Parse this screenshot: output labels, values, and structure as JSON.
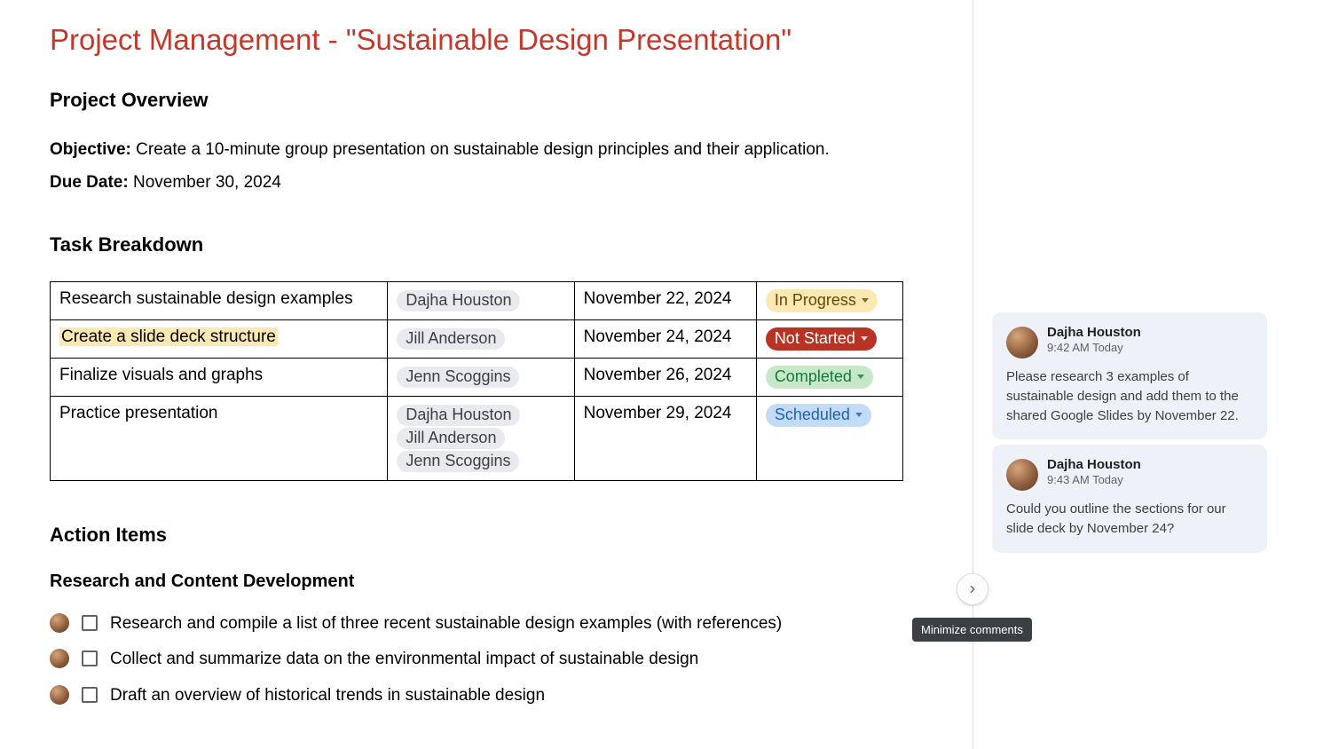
{
  "title": "Project Management - \"Sustainable Design Presentation\"",
  "overview": {
    "heading": "Project Overview",
    "objective_label": "Objective: ",
    "objective_text": "Create a 10-minute group presentation on sustainable design principles and their application.",
    "due_label": "Due Date: ",
    "due_text": "November 30, 2024"
  },
  "tasks": {
    "heading": "Task Breakdown",
    "rows": [
      {
        "task": "Research sustainable design examples",
        "highlight": false,
        "people": [
          "Dajha Houston"
        ],
        "date": "November 22, 2024",
        "status": "In Progress",
        "status_class": "st-progress"
      },
      {
        "task": "Create a slide deck structure",
        "highlight": true,
        "people": [
          "Jill Anderson"
        ],
        "date": "November 24, 2024",
        "status": "Not Started",
        "status_class": "st-notstart"
      },
      {
        "task": "Finalize visuals and graphs",
        "highlight": false,
        "people": [
          "Jenn Scoggins"
        ],
        "date": "November 26, 2024",
        "status": "Completed",
        "status_class": "st-completed"
      },
      {
        "task": "Practice presentation",
        "highlight": false,
        "people": [
          "Dajha Houston",
          "Jill Anderson",
          "Jenn Scoggins"
        ],
        "date": "November 29, 2024",
        "status": "Scheduled",
        "status_class": "st-scheduled"
      }
    ]
  },
  "action": {
    "heading": "Action Items",
    "sub": "Research and Content Development",
    "items": [
      "Research and compile a list of three recent sustainable design examples (with references)",
      "Collect and summarize data on the environmental impact of sustainable design",
      "Draft an overview of historical trends in sustainable design"
    ]
  },
  "comments": [
    {
      "name": "Dajha Houston",
      "time": "9:42 AM Today",
      "body": "Please research 3 examples of sustainable design and add them to the shared Google Slides by November 22."
    },
    {
      "name": "Dajha Houston",
      "time": "9:43 AM Today",
      "body": "Could you outline the sections for our slide deck by November 24?"
    }
  ],
  "tooltip": "Minimize comments"
}
